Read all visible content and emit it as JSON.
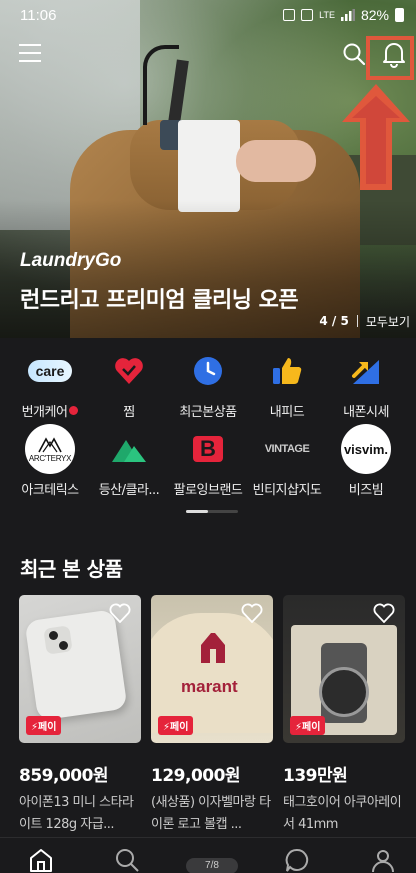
{
  "status_bar": {
    "time": "11:06",
    "network": "LTE",
    "battery": "82%"
  },
  "hero": {
    "brand": "LaundryGo",
    "title": "런드리고 프리미엄 클리닝 오픈",
    "page_current": "4",
    "page_total": "5",
    "count_text": "4 / 5",
    "view_all": "모두보기"
  },
  "shortcuts": [
    {
      "icon": "care-icon",
      "icon_text": "care",
      "label": "번개케어",
      "has_dot": true
    },
    {
      "icon": "heart-icon",
      "label": "찜"
    },
    {
      "icon": "clock-icon",
      "label": "최근본상품"
    },
    {
      "icon": "thumbs-up-icon",
      "label": "내피드"
    },
    {
      "icon": "price-chart-icon",
      "label": "내폰시세"
    },
    {
      "icon": "arcteryx-logo",
      "icon_text": "ARC'TERYX",
      "label": "아크테릭스"
    },
    {
      "icon": "mountain-icon",
      "label": "등산/클라..."
    },
    {
      "icon": "b-logo",
      "icon_text": "B",
      "label": "팔로잉브랜드"
    },
    {
      "icon": "vintage-logo",
      "icon_text": "VINTAGE",
      "label": "빈티지샵지도"
    },
    {
      "icon": "visvim-logo",
      "icon_text": "visvim.",
      "label": "비즈빔"
    }
  ],
  "recent": {
    "title": "최근 본 상품",
    "pay_label": "페이",
    "items": [
      {
        "price": "859,000원",
        "name": "아이폰13 미니 스타라이트 128g 자급..."
      },
      {
        "price": "129,000원",
        "name": "(새상품) 이자벨마랑 타이론 로고 볼캡 ...",
        "cap_text": "marant"
      },
      {
        "price": "139만원",
        "name": "태그호이어 아쿠아레이서 41mm"
      }
    ]
  },
  "bottom_nav": {
    "page_indicator": "7/8",
    "items": [
      "home-icon",
      "search-icon",
      "chat-icon",
      "profile-icon"
    ]
  },
  "colors": {
    "background": "#1a1a1c",
    "accent_red": "#e5243b",
    "highlight": "#e0583c"
  }
}
